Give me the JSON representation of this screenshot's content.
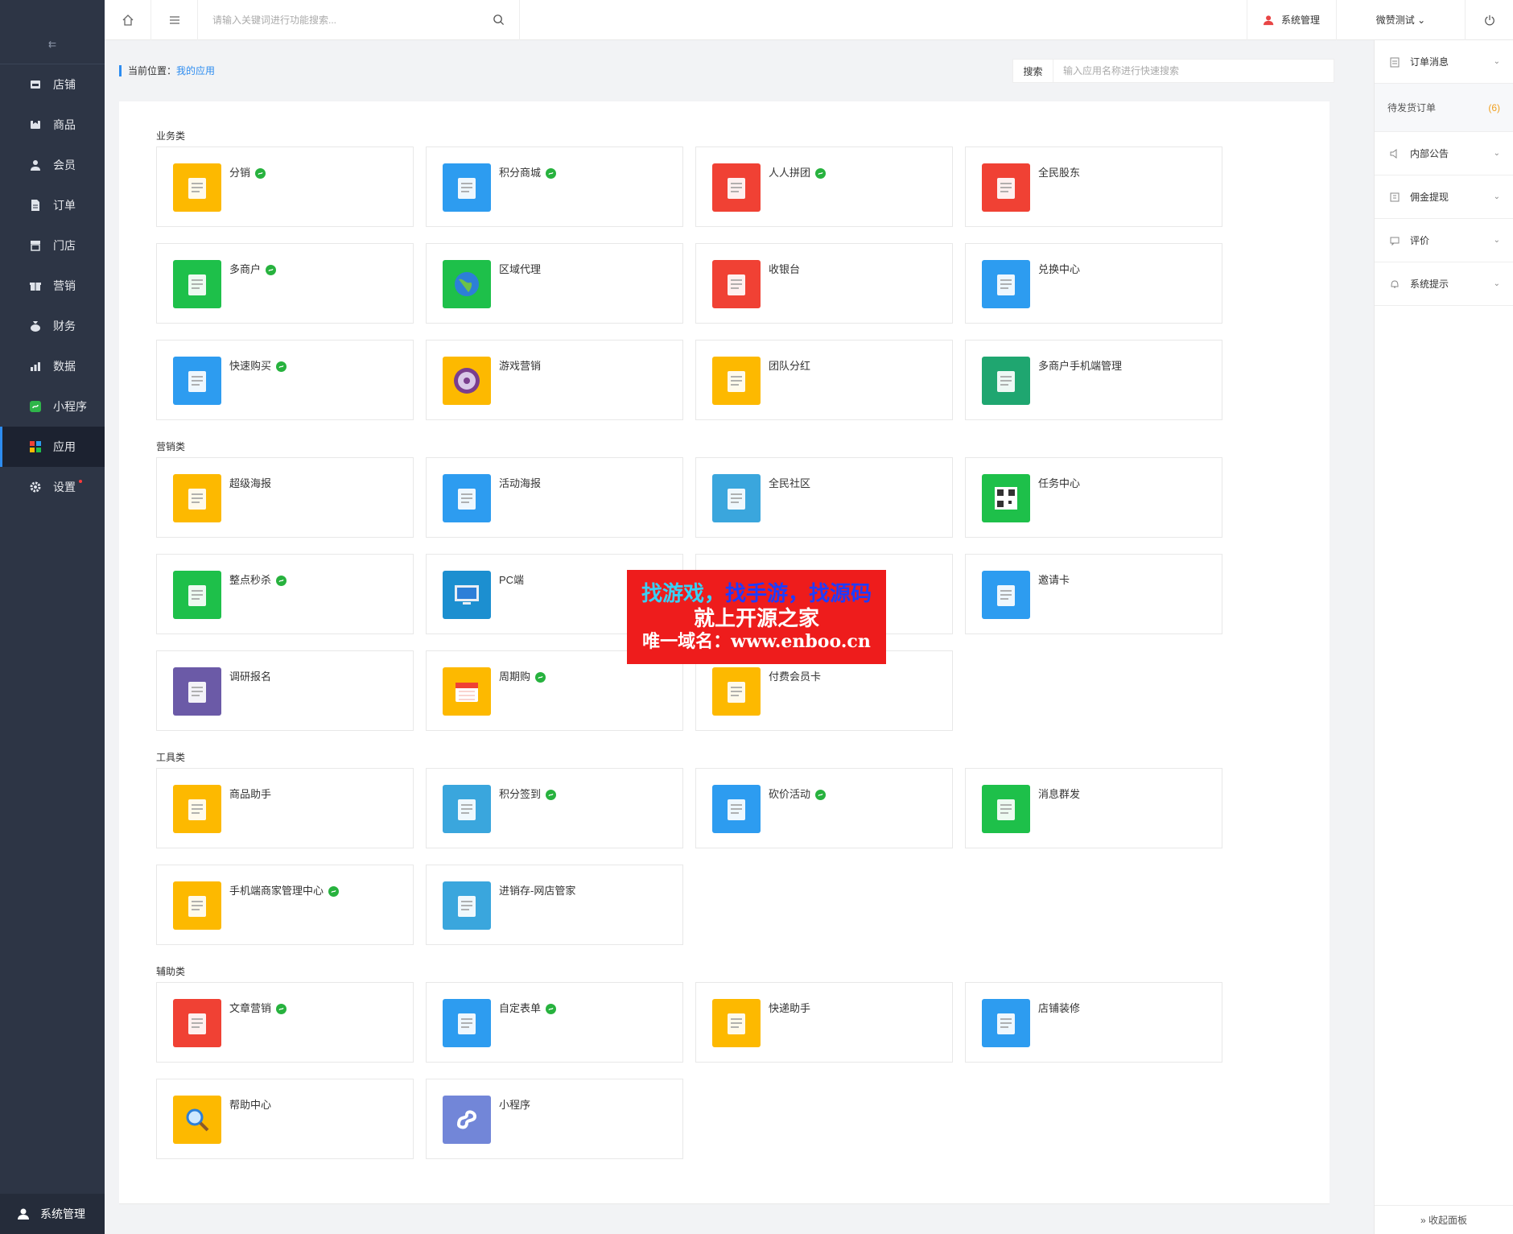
{
  "sidebar": {
    "items": [
      {
        "label": "店铺",
        "icon": "store-icon"
      },
      {
        "label": "商品",
        "icon": "goods-icon"
      },
      {
        "label": "会员",
        "icon": "member-icon"
      },
      {
        "label": "订单",
        "icon": "order-icon"
      },
      {
        "label": "门店",
        "icon": "shop-icon"
      },
      {
        "label": "营销",
        "icon": "gift-icon"
      },
      {
        "label": "财务",
        "icon": "money-bag-icon"
      },
      {
        "label": "数据",
        "icon": "chart-icon"
      },
      {
        "label": "小程序",
        "icon": "miniprogram-icon"
      },
      {
        "label": "应用",
        "icon": "apps-icon",
        "active": true
      },
      {
        "label": "设置",
        "icon": "gear-icon",
        "badge": true
      }
    ],
    "bottom_label": "系统管理"
  },
  "topbar": {
    "search_placeholder": "请输入关键词进行功能搜索...",
    "admin_label": "系统管理",
    "user_label": "微赞测试 ⌄"
  },
  "breadcrumb": {
    "prefix": "当前位置：",
    "current": "我的应用"
  },
  "app_search": {
    "label": "搜索",
    "placeholder": "输入应用名称进行快速搜索"
  },
  "right_panel": {
    "order_msg": "订单消息",
    "pending_orders": "待发货订单",
    "pending_count": "(6)",
    "notice": "内部公告",
    "commission": "佣金提现",
    "review": "评价",
    "system_tip": "系统提示",
    "collapse": "» 收起面板"
  },
  "categories": [
    {
      "title": "业务类",
      "apps": [
        {
          "name": "分销",
          "mini": true,
          "color": "#fdb900",
          "icon": "distribution-icon"
        },
        {
          "name": "积分商城",
          "mini": true,
          "color": "#2d9cf0",
          "icon": "shopping-bag-icon"
        },
        {
          "name": "人人拼团",
          "mini": true,
          "color": "#f04134",
          "icon": "group-buy-icon"
        },
        {
          "name": "全民股东",
          "mini": false,
          "color": "#f04134",
          "icon": "shareholder-icon"
        },
        {
          "name": "多商户",
          "mini": true,
          "color": "#1ec04a",
          "icon": "merchant-store-icon"
        },
        {
          "name": "区域代理",
          "mini": false,
          "color": "#1ec04a",
          "icon": "globe-icon"
        },
        {
          "name": "收银台",
          "mini": false,
          "color": "#f04134",
          "icon": "cash-register-icon"
        },
        {
          "name": "兑换中心",
          "mini": false,
          "color": "#2d9cf0",
          "icon": "gift-box-icon"
        },
        {
          "name": "快速购买",
          "mini": true,
          "color": "#2d9cf0",
          "icon": "cart-icon"
        },
        {
          "name": "游戏营销",
          "mini": false,
          "color": "#fdb900",
          "icon": "wheel-icon"
        },
        {
          "name": "团队分红",
          "mini": false,
          "color": "#fdb900",
          "icon": "red-packet-icon"
        },
        {
          "name": "多商户手机端管理",
          "mini": false,
          "color": "#1fa670",
          "icon": "mobile-manage-icon"
        }
      ]
    },
    {
      "title": "营销类",
      "apps": [
        {
          "name": "超级海报",
          "mini": false,
          "color": "#fdb900",
          "icon": "poster-icon"
        },
        {
          "name": "活动海报",
          "mini": false,
          "color": "#2d9cf0",
          "icon": "picture-icon"
        },
        {
          "name": "全民社区",
          "mini": false,
          "color": "#3aa6dd",
          "icon": "community-icon"
        },
        {
          "name": "任务中心",
          "mini": false,
          "color": "#1ec04a",
          "icon": "qrcode-icon"
        },
        {
          "name": "整点秒杀",
          "mini": true,
          "color": "#1ec04a",
          "icon": "alarm-clock-icon"
        },
        {
          "name": "PC端",
          "mini": false,
          "color": "#1c8fd0",
          "icon": "monitor-icon"
        },
        {
          "name": "",
          "mini": false,
          "color": "#ffffff",
          "icon": "hidden-icon"
        },
        {
          "name": "邀请卡",
          "mini": false,
          "color": "#2d9cf0",
          "icon": "invite-card-icon"
        },
        {
          "name": "调研报名",
          "mini": false,
          "color": "#6b5aa7",
          "icon": "survey-icon"
        },
        {
          "name": "周期购",
          "mini": true,
          "color": "#fdb900",
          "icon": "calendar-icon"
        },
        {
          "name": "付费会员卡",
          "mini": false,
          "color": "#fdb900",
          "icon": "crown-card-icon"
        }
      ]
    },
    {
      "title": "工具类",
      "apps": [
        {
          "name": "商品助手",
          "mini": false,
          "color": "#fdb900",
          "icon": "goods-helper-icon"
        },
        {
          "name": "积分签到",
          "mini": true,
          "color": "#3aa6dd",
          "icon": "sign-in-pin-icon"
        },
        {
          "name": "砍价活动",
          "mini": true,
          "color": "#2d9cf0",
          "icon": "axe-icon"
        },
        {
          "name": "消息群发",
          "mini": false,
          "color": "#1ec04a",
          "icon": "broadcast-icon"
        },
        {
          "name": "手机端商家管理中心",
          "mini": true,
          "color": "#fdb900",
          "icon": "phone-icon"
        },
        {
          "name": "进销存-网店管家",
          "mini": false,
          "color": "#3aa6dd",
          "icon": "inventory-icon"
        }
      ]
    },
    {
      "title": "辅助类",
      "apps": [
        {
          "name": "文章营销",
          "mini": true,
          "color": "#f04134",
          "icon": "article-icon"
        },
        {
          "name": "自定表单",
          "mini": true,
          "color": "#2d9cf0",
          "icon": "form-icon"
        },
        {
          "name": "快递助手",
          "mini": false,
          "color": "#fdb900",
          "icon": "truck-icon"
        },
        {
          "name": "店铺装修",
          "mini": false,
          "color": "#2d9cf0",
          "icon": "brush-icon"
        },
        {
          "name": "帮助中心",
          "mini": false,
          "color": "#fdb900",
          "icon": "magnifier-icon"
        },
        {
          "name": "小程序",
          "mini": false,
          "color": "#7286d8",
          "icon": "miniprogram-logo-icon"
        }
      ]
    }
  ],
  "watermark": {
    "part1": "找游戏，",
    "part2": "找手游，",
    "part3": "找源码",
    "line2": "就上开源之家",
    "line3": "唯一域名：www.enboo.cn"
  }
}
